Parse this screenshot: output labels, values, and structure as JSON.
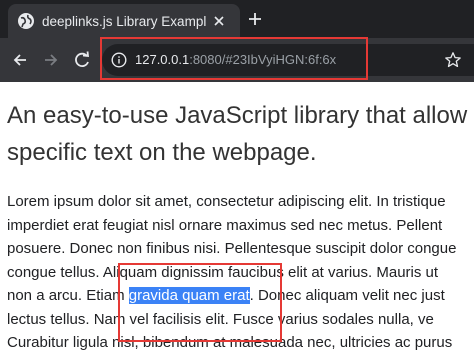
{
  "browser": {
    "tab": {
      "title": "deeplinks.js Library Example",
      "favicon": "globe-icon",
      "close_icon": "close-icon"
    },
    "new_tab_icon": "plus-icon",
    "toolbar": {
      "back_icon": "arrow-left-icon",
      "forward_icon": "arrow-right-icon",
      "reload_icon": "reload-icon",
      "info_icon": "info-icon",
      "bookmark_icon": "star-icon"
    },
    "address_bar": {
      "host": "127.0.0.1",
      "rest": ":8080/#23IbVyiHGN:6f:6x"
    }
  },
  "page": {
    "headline_lines": [
      "An easy-to-use JavaScript library that allow",
      "specific text on the webpage."
    ],
    "paragraph": {
      "line1": "Lorem ipsum dolor sit amet, consectetur adipiscing elit. In tristique",
      "line2": "imperdiet erat feugiat nisl ornare maximus sed nec metus. Pellent",
      "line3": "posuere. Donec non finibus nisi. Pellentesque suscipit dolor congue",
      "line4": "congue tellus. Aliquam dignissim faucibus elit at varius. Mauris ut",
      "line5_before": "non a arcu. Etiam ",
      "line5_selected": "gravida quam erat",
      "line5_after": ". Donec aliquam velit nec just",
      "line6": "lectus tellus. Nam vel facilisis elit. Fusce varius sodales nulla, ve",
      "line7": "Curabitur ligula nisl, bibendum at malesuada nec, ultricies ac purus"
    }
  },
  "colors": {
    "annotation_box": "#e53935",
    "selection": "#3b82f6",
    "tabstrip": "#202124",
    "toolbar": "#35363a"
  }
}
